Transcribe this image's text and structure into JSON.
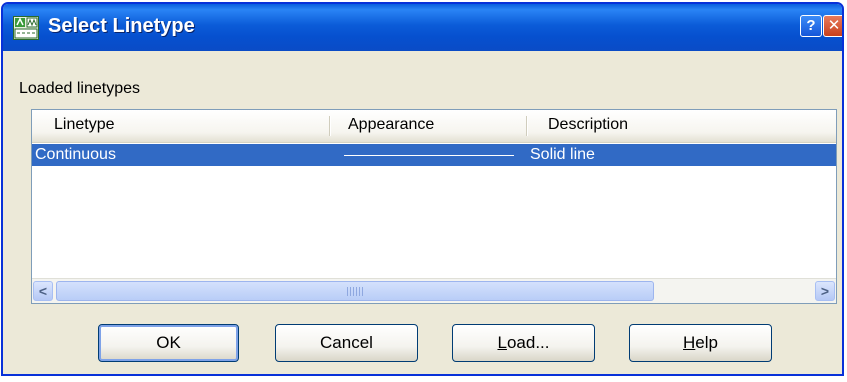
{
  "window": {
    "title": "Select Linetype",
    "title_icon": "linetype-app-icon",
    "help_label": "?",
    "close_label": "✕"
  },
  "group": {
    "label": "Loaded linetypes"
  },
  "list": {
    "columns": [
      "Linetype",
      "Appearance",
      "Description"
    ],
    "rows": [
      {
        "linetype": "Continuous",
        "appearance": "solid-line",
        "description": "Solid line",
        "selected": true
      }
    ]
  },
  "scrollbar": {
    "left_arrow": "<",
    "right_arrow": ">"
  },
  "buttons": {
    "ok": "OK",
    "cancel": "Cancel",
    "load_mnemonic": "L",
    "load_rest": "oad...",
    "help_mnemonic": "H",
    "help_rest": "elp"
  },
  "colors": {
    "selection": "#316ac5",
    "titlebar": "#0b5bd8",
    "dialog_bg": "#ece9d8"
  }
}
